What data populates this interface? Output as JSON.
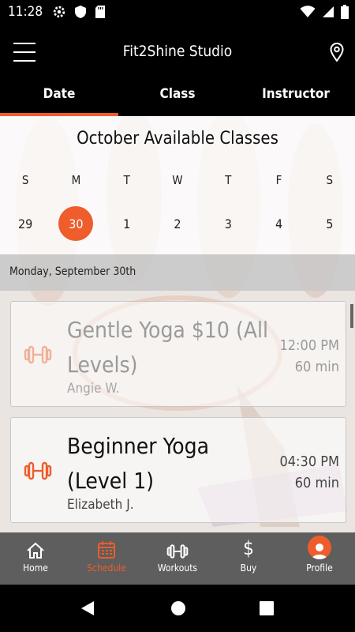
{
  "status_bar": {
    "time": "11:28"
  },
  "app_bar": {
    "title": "Fit2Shine Studio"
  },
  "tabs": [
    {
      "label": "Date",
      "active": true
    },
    {
      "label": "Class",
      "active": false
    },
    {
      "label": "Instructor",
      "active": false
    }
  ],
  "calendar": {
    "title": "October Available Classes",
    "weekdays": [
      "S",
      "M",
      "T",
      "W",
      "T",
      "F",
      "S"
    ],
    "dates": [
      "29",
      "30",
      "1",
      "2",
      "3",
      "4",
      "5"
    ],
    "selected_index": 1
  },
  "day_header": "Monday, September 30th",
  "classes": [
    {
      "name": "Gentle Yoga $10 (All Levels)",
      "instructor": "Angie W.",
      "time": "12:00 PM",
      "duration": "60 min",
      "icon": "dumbbell-icon"
    },
    {
      "name": "Beginner Yoga (Level 1)",
      "instructor": "Elizabeth J.",
      "time": "04:30 PM",
      "duration": "60 min",
      "icon": "dumbbell-icon"
    }
  ],
  "bottom_nav": [
    {
      "label": "Home",
      "icon": "home-icon"
    },
    {
      "label": "Schedule",
      "icon": "calendar-icon",
      "active": true
    },
    {
      "label": "Workouts",
      "icon": "dumbbell-icon"
    },
    {
      "label": "Buy",
      "icon": "dollar-icon"
    },
    {
      "label": "Profile",
      "icon": "avatar-icon"
    }
  ],
  "colors": {
    "accent": "#ee5d2b",
    "bar": "#000000",
    "nav": "#5e5e5e"
  }
}
